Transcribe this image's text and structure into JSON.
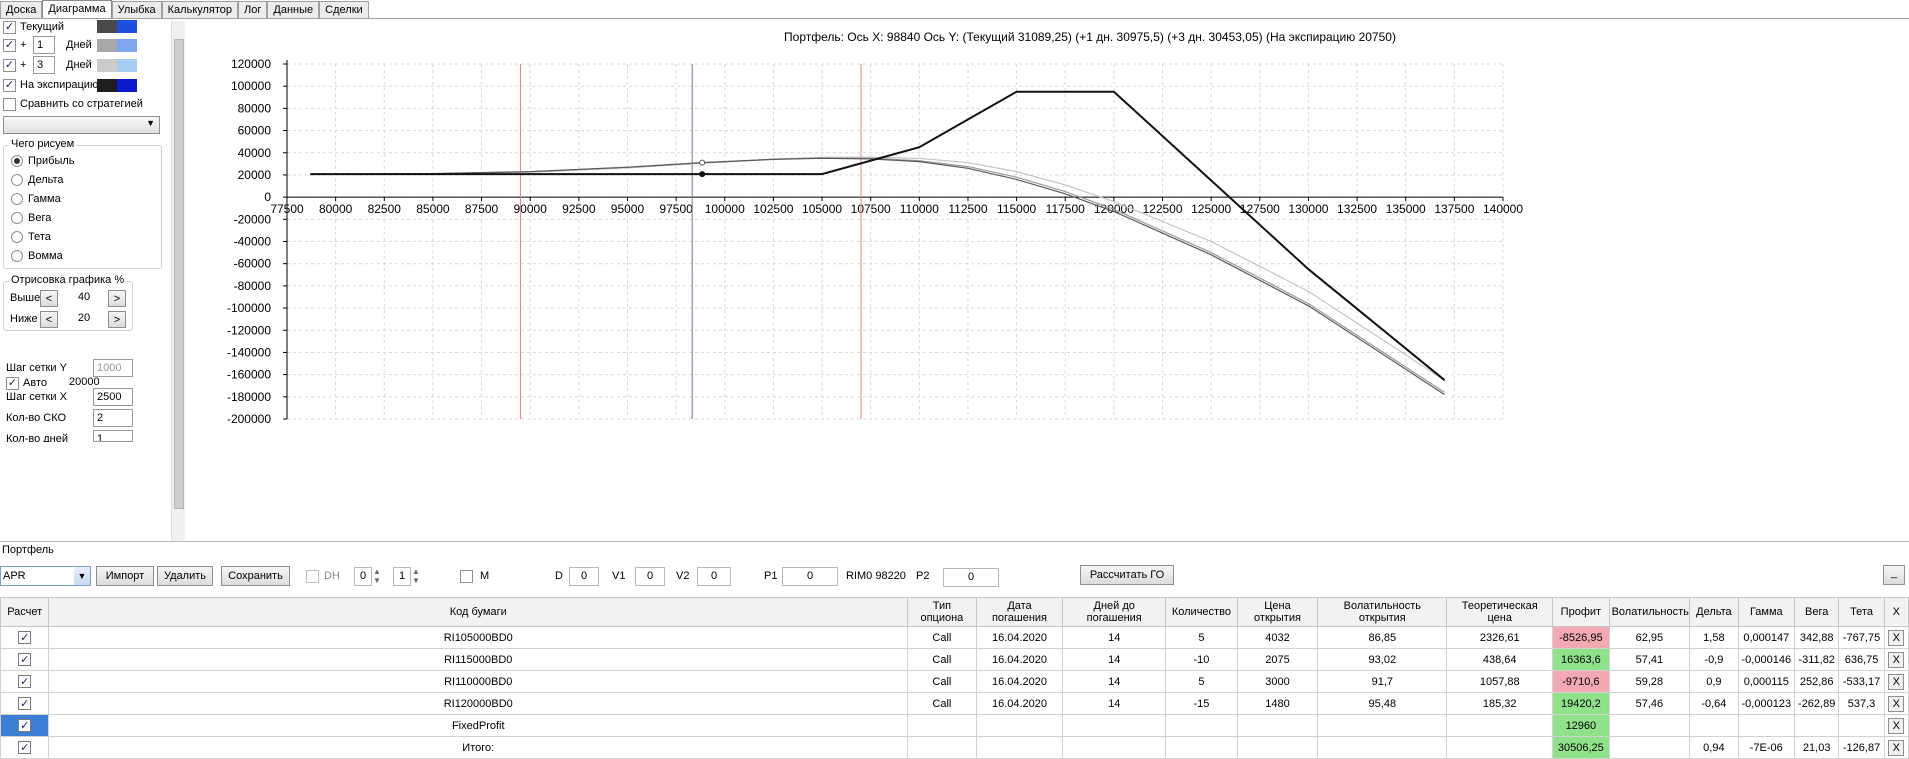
{
  "tabs": [
    "Доска",
    "Диаграмма",
    "Улыбка",
    "Калькулятор",
    "Лог",
    "Данные",
    "Сделки"
  ],
  "active_tab": "Диаграмма",
  "left": {
    "current_label": "Текущий",
    "plus1_value": "1",
    "plus_sign": "+",
    "days_label": "Дней",
    "plus3_value": "3",
    "expiry_label": "На экспирацию",
    "compare_label": "Сравнить со стратегией",
    "draw_group_title": "Чего рисуем",
    "draw_options": [
      "Прибыль",
      "Дельта",
      "Гамма",
      "Вега",
      "Тета",
      "Вомма"
    ],
    "render_group_title": "Отрисовка графика %",
    "above_label": "Выше",
    "above_value": "40",
    "below_label": "Ниже",
    "below_value": "20",
    "grid_y_label": "Шаг сетки Y",
    "grid_y_value": "1000",
    "auto_label": "Авто",
    "auto_value": "20000",
    "grid_x_label": "Шаг сетки X",
    "grid_x_value": "2500",
    "sko_label": "Кол-во СКО",
    "sko_value": "2",
    "days_count_label": "Кол-во дней",
    "days_count_value": "1",
    "btn_left": "<",
    "btn_right": ">",
    "swatch_colors": {
      "current_a": "#4a4a4a",
      "current_b": "#1f4fe0",
      "p1_a": "#a8a8a8",
      "p1_b": "#7fa7ee",
      "p3_a": "#cbcbcb",
      "p3_b": "#a8cdf5",
      "exp_a": "#1e1e1e",
      "exp_b": "#0a1ad0"
    }
  },
  "chart_title": "Портфель: Ось X: 98840 Ось Y:  (Текущий 31089,25)  (+1 дн. 30975,5)  (+3 дн. 30453,05)  (На экспирацию 20750)",
  "chart_data": {
    "type": "line",
    "x_ticks": [
      77500,
      80000,
      82500,
      85000,
      87500,
      90000,
      92500,
      95000,
      97500,
      100000,
      102500,
      105000,
      107500,
      110000,
      112500,
      115000,
      117500,
      120000,
      122500,
      125000,
      127500,
      130000,
      132500,
      135000,
      137500,
      140000
    ],
    "y_ticks": [
      120000,
      100000,
      80000,
      60000,
      40000,
      20000,
      0,
      -20000,
      -40000,
      -60000,
      -80000,
      -100000,
      -120000,
      -140000,
      -160000,
      -180000,
      -200000
    ],
    "xlim": [
      77500,
      140000
    ],
    "ylim": [
      -200000,
      120000
    ],
    "cursor_x": 98840,
    "sd_lines_x": [
      89500,
      107000
    ],
    "series": [
      {
        "name": "На экспирацию",
        "color": "#111111",
        "x": [
          78700,
          105000,
          110000,
          115000,
          120000,
          125000,
          130000,
          137000
        ],
        "y": [
          20750,
          20750,
          45000,
          95000,
          95000,
          15000,
          -65000,
          -165000
        ]
      },
      {
        "name": "Текущий",
        "color": "#5a5a5a",
        "x": [
          78700,
          85000,
          90000,
          95000,
          98840,
          102500,
          105000,
          107500,
          110000,
          112500,
          115000,
          117500,
          120000,
          125000,
          130000,
          137000
        ],
        "y": [
          20500,
          21200,
          23000,
          27000,
          31089,
          34000,
          35000,
          34500,
          32000,
          26000,
          16000,
          3000,
          -13000,
          -52000,
          -98000,
          -178000
        ]
      },
      {
        "name": "+1 дн.",
        "color": "#9a9a9a",
        "x": [
          78700,
          85000,
          90000,
          95000,
          98840,
          102500,
          105000,
          107500,
          110000,
          112500,
          115000,
          117500,
          120000,
          125000,
          130000,
          137000
        ],
        "y": [
          20500,
          21100,
          22800,
          26800,
          30975,
          34200,
          35300,
          35000,
          32800,
          27500,
          18000,
          5000,
          -11000,
          -50000,
          -96000,
          -176000
        ]
      },
      {
        "name": "+3 дн.",
        "color": "#c4c4c4",
        "x": [
          78700,
          85000,
          90000,
          95000,
          98840,
          102500,
          105000,
          107500,
          110000,
          112500,
          115000,
          117500,
          120000,
          125000,
          130000,
          137000
        ],
        "y": [
          20500,
          21000,
          22500,
          26300,
          30453,
          34300,
          35800,
          36000,
          35000,
          31000,
          23000,
          11000,
          -4000,
          -40000,
          -85000,
          -165000
        ]
      }
    ]
  },
  "portfolio": {
    "header": "Портфель",
    "select_value": "APR",
    "import_btn": "Импорт",
    "delete_btn": "Удалить",
    "save_btn": "Сохранить",
    "dh_label": "DH",
    "dh_val1": "0",
    "dh_val2": "1",
    "m_label": "M",
    "d_label": "D",
    "d_value": "0",
    "v1_label": "V1",
    "v1_value": "0",
    "v2_label": "V2",
    "v2_value": "0",
    "p1_label": "P1",
    "p1_value": "0",
    "rim_label": "RIM0 98220",
    "p2_label": "P2",
    "p2_value": "0",
    "calc_btn": "Рассчитать ГО",
    "min_btn": "_"
  },
  "table": {
    "headers": [
      "Расчет",
      "Код бумаги",
      "Тип опциона",
      "Дата погашения",
      "Дней до погашения",
      "Количество",
      "Цена открытия",
      "Волатильность открытия",
      "Теоретическая цена",
      "Профит",
      "Волатильность",
      "Дельта",
      "Гамма",
      "Вега",
      "Тета",
      "X"
    ],
    "rows": [
      {
        "code": "RI105000BD0",
        "type": "Call",
        "date": "16.04.2020",
        "days": "14",
        "qty": "5",
        "price": "4032",
        "vol_open": "86,85",
        "theo": "2326,61",
        "profit": "-8526,95",
        "profit_sign": "neg",
        "vol": "62,95",
        "delta": "1,58",
        "gamma": "0,000147",
        "vega": "342,88",
        "theta": "-767,75",
        "x": "X"
      },
      {
        "code": "RI115000BD0",
        "type": "Call",
        "date": "16.04.2020",
        "days": "14",
        "qty": "-10",
        "price": "2075",
        "vol_open": "93,02",
        "theo": "438,64",
        "profit": "16363,6",
        "profit_sign": "pos",
        "vol": "57,41",
        "delta": "-0,9",
        "gamma": "-0,000146",
        "vega": "-311,82",
        "theta": "636,75",
        "x": "X"
      },
      {
        "code": "RI110000BD0",
        "type": "Call",
        "date": "16.04.2020",
        "days": "14",
        "qty": "5",
        "price": "3000",
        "vol_open": "91,7",
        "theo": "1057,88",
        "profit": "-9710,6",
        "profit_sign": "neg",
        "vol": "59,28",
        "delta": "0,9",
        "gamma": "0,000115",
        "vega": "252,86",
        "theta": "-533,17",
        "x": "X"
      },
      {
        "code": "RI120000BD0",
        "type": "Call",
        "date": "16.04.2020",
        "days": "14",
        "qty": "-15",
        "price": "1480",
        "vol_open": "95,48",
        "theo": "185,32",
        "profit": "19420,2",
        "profit_sign": "pos",
        "vol": "57,46",
        "delta": "-0,64",
        "gamma": "-0,000123",
        "vega": "-262,89",
        "theta": "537,3",
        "x": "X"
      },
      {
        "code": "FixedProfit",
        "type": "",
        "date": "",
        "days": "",
        "qty": "",
        "price": "",
        "vol_open": "",
        "theo": "",
        "profit": "12960",
        "profit_sign": "pos",
        "vol": "",
        "delta": "",
        "gamma": "",
        "vega": "",
        "theta": "",
        "x": "X"
      },
      {
        "code": "Итого:",
        "type": "",
        "date": "",
        "days": "",
        "qty": "",
        "price": "",
        "vol_open": "",
        "theo": "",
        "profit": "30506,25",
        "profit_sign": "pos",
        "vol": "",
        "delta": "0,94",
        "gamma": "-7E-06",
        "vega": "21,03",
        "theta": "-126,87",
        "x": "X"
      }
    ]
  }
}
